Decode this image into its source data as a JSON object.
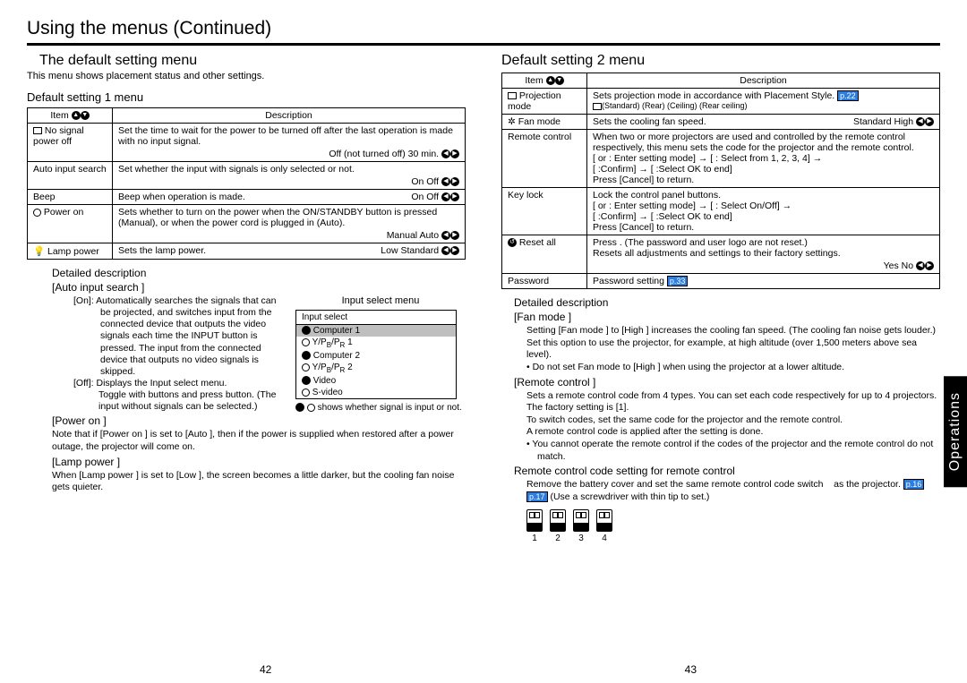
{
  "header": {
    "main_title": "Using the menus (Continued)"
  },
  "sidebar": {
    "label": "Operations"
  },
  "left": {
    "subtitle": "The default setting menu",
    "intro": "This menu shows placement status and other settings.",
    "menu1_title": "Default setting 1 menu",
    "table1": {
      "col_item": "Item",
      "col_desc": "Description",
      "r1_item": "No signal power off",
      "r1_desc": "Set the time to wait for the power to be turned off after the last operation is made with no input signal.",
      "r1_opt": "Off (not turned off)       30 min.",
      "r2_item": "Auto input search",
      "r2_desc": "Set whether the input with signals is only selected or not.",
      "r2_opt": "On       Off",
      "r3_item": "Beep",
      "r3_desc": "Beep when operation is made.",
      "r3_opt": "On       Off",
      "r4_item": "Power on",
      "r4_desc": "Sets whether to turn on the power when the ON/STANDBY button is pressed (Manual), or when the power cord is plugged in (Auto).",
      "r4_opt": "Manual          Auto",
      "r5_item": "Lamp power",
      "r5_desc": "Sets the lamp power.",
      "r5_opt": "Low       Standard"
    },
    "detail": {
      "heading": "Detailed description",
      "auto_input_label": "[Auto input search ]",
      "on_label": "[On]:",
      "on_text": "Automatically searches the signals that can be projected, and switches input from the connected device that outputs the video signals each time the INPUT button is pressed. The input from the connected device that outputs no video signals is skipped.",
      "off_label": "[Off]:",
      "off_text": "Displays the Input select  menu.",
      "toggle_text": "Toggle with        buttons and press      button. (The input without signals can be selected.)",
      "input_menu_title": "Input select menu",
      "input_box_title": "Input select",
      "input1": "Computer 1",
      "input2": "Y/PB/PR 1",
      "input3": "Computer 2",
      "input4": "Y/PB/PR 2",
      "input5": "Video",
      "input6": "S-video",
      "signal_note": "    shows whether signal is input or not.",
      "poweron_label": "[Power on ]",
      "poweron_text": "Note that if [Power on ] is set to [Auto ], then if the power is supplied when restored after a power outage, the projector will come on.",
      "lamp_label": "[Lamp power ]",
      "lamp_text": "When [Lamp power ] is set to [Low ], the screen becomes a little darker, but the cooling fan noise gets quieter."
    }
  },
  "right": {
    "menu2_title": "Default setting 2 menu",
    "table2": {
      "col_item": "Item",
      "col_desc": "Description",
      "r1_item": "Projection mode",
      "r1_desc": "Sets projection mode in accordance with Placement Style.",
      "r1_pref": "p.22",
      "r1_opt": "(Standard)               (Rear)               (Ceiling)               (Rear ceiling)",
      "r2_item": "Fan mode",
      "r2_desc": "Sets the cooling fan speed.",
      "r2_opt": "Standard         High",
      "r3_item": "Remote control",
      "r3_desc": "When two or more projectors are used and controlled by the remote control respectively, this menu sets the code for the projector and the remote control.",
      "r3_step1": "[     or      : Enter setting mode] → [        : Select from 1, 2, 3, 4] →",
      "r3_step2": "[     :Confirm] → [        :Select OK to end]",
      "r3_step3": "Press [Cancel] to return.",
      "r4_item": "Key lock",
      "r4_desc": "Lock the control panel buttons.",
      "r4_step1": "[     or      : Enter setting mode] → [        : Select On/Off] →",
      "r4_step2": "[     :Confirm] → [        :Select OK to end]",
      "r4_step3": "Press [Cancel] to return.",
      "r5_item": "Reset all",
      "r5_desc": "Press      . (The password and user logo are not reset.)",
      "r5_desc2": "Resets all adjustments and settings to their factory settings.",
      "r5_opt": "Yes        No",
      "r6_item": "Password",
      "r6_desc": "Password setting",
      "r6_pref": "p.33"
    },
    "detail": {
      "heading": "Detailed description",
      "fan_label": "[Fan mode ]",
      "fan_text": "Setting [Fan mode ] to [High ] increases the cooling fan speed. (The cooling fan noise gets louder.) Set this option to use the projector, for example, at high altitude (over 1,500 meters above sea level).",
      "fan_warn": "Do not set Fan mode to [High ] when using the projector at a lower altitude.",
      "remote_label": "[Remote control ]",
      "remote_text1": "Sets a remote control code from 4 types. You can set each code respectively for up to 4 projectors. The factory setting is [1].",
      "remote_text2": "To switch codes, set the same code for the projector and the remote control.",
      "remote_text3": "A remote control code is applied after the setting is done.",
      "remote_warn": "You cannot operate the remote control if the codes of the projector and the remote control do not match.",
      "rc_setting_label": "Remote control code setting for remote control",
      "rc_setting_text": "Remove the battery cover and set the same remote control code switch    as the projector.               (Use a screwdriver with thin tip to set.)",
      "pref16": "p.16",
      "pref17": "p.17",
      "rc1": "1",
      "rc2": "2",
      "rc3": "3",
      "rc4": "4"
    }
  },
  "pages": {
    "left": "42",
    "right": "43"
  }
}
